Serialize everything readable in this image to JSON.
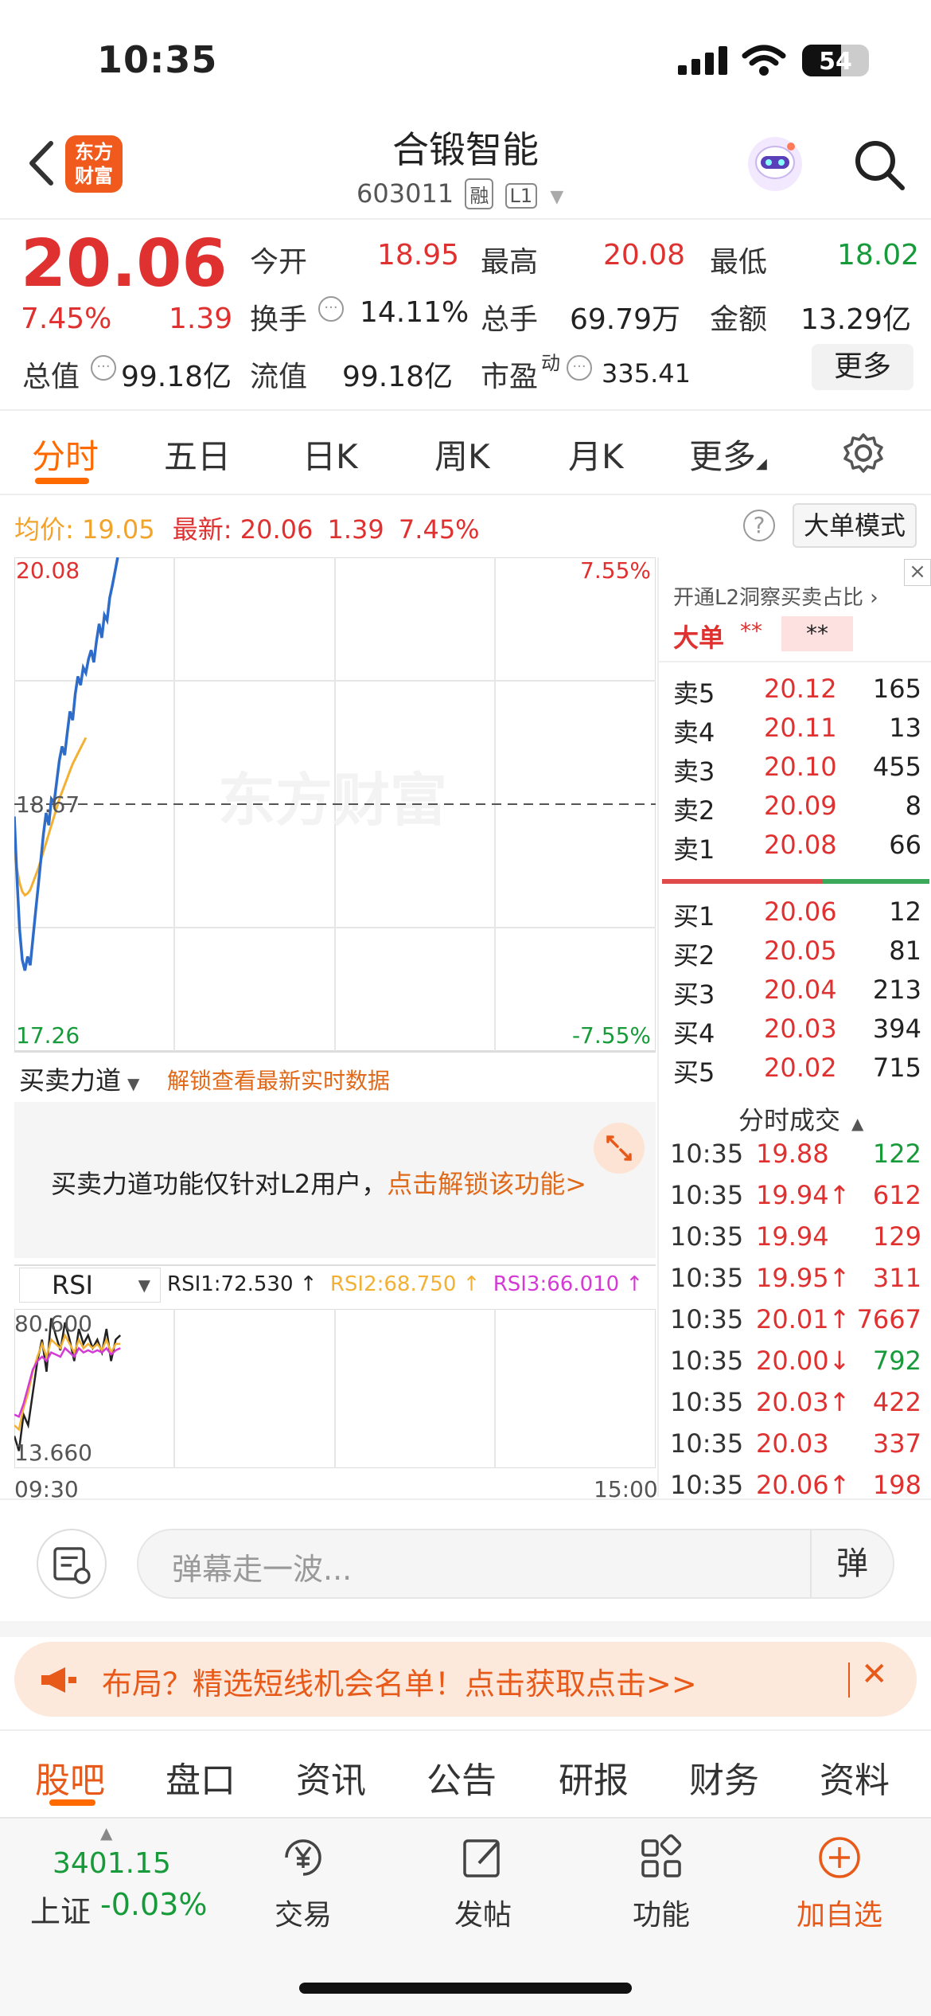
{
  "status_bar": {
    "time": "10:35",
    "battery": "54"
  },
  "header": {
    "logo_line1": "东方",
    "logo_line2": "财富",
    "stock_name": "合锻智能",
    "stock_code": "603011",
    "tag1": "融",
    "tag2": "L1"
  },
  "quote": {
    "price": "20.06",
    "change_pct": "7.45%",
    "change_amt": "1.39",
    "open_label": "今开",
    "open_value": "18.95",
    "high_label": "最高",
    "high_value": "20.08",
    "low_label": "最低",
    "low_value": "18.02",
    "turnover_label": "换手",
    "turnover_value": "14.11%",
    "volume_label": "总手",
    "volume_value": "69.79万",
    "amount_label": "金额",
    "amount_value": "13.29亿",
    "mktcap_label": "总值",
    "mktcap_value": "99.18亿",
    "float_label": "流值",
    "float_value": "99.18亿",
    "pe_label": "市盈",
    "pe_sup": "动",
    "pe_value": "335.41",
    "more_label": "更多"
  },
  "tabs": [
    "分时",
    "五日",
    "日K",
    "周K",
    "月K",
    "更多"
  ],
  "info_line": {
    "avg_label": "均价:",
    "avg_value": "19.05",
    "latest_label": "最新:",
    "latest_value": "20.06",
    "latest_chg": "1.39",
    "latest_pct": "7.45%",
    "bigorder_mode": "大单模式"
  },
  "chart": {
    "price_high": "20.08",
    "price_low": "17.26",
    "price_mid": "18.67",
    "pct_high": "7.55%",
    "pct_low": "-7.55%",
    "watermark": "东方财富",
    "time_start": "09:30",
    "time_end": "15:00"
  },
  "chart_data": {
    "type": "line",
    "ylim": [
      17.26,
      20.08
    ],
    "reference": 18.67,
    "series": [
      {
        "values": [
          18.6,
          18.25,
          17.95,
          17.78,
          17.72,
          17.8,
          17.75,
          17.9,
          18.05,
          18.2,
          18.35,
          18.5,
          18.62,
          18.55,
          18.7,
          18.68,
          18.8,
          18.92,
          19.0,
          18.95,
          19.08,
          19.2,
          19.15,
          19.3,
          19.4,
          19.35,
          19.45,
          19.42,
          19.5,
          19.55,
          19.48,
          19.6,
          19.7,
          19.62,
          19.75,
          19.72,
          19.85,
          19.92,
          20.0,
          20.08
        ]
      },
      {
        "values": [
          18.4,
          18.3,
          18.22,
          18.17,
          18.15,
          18.16,
          18.18,
          18.22,
          18.26,
          18.3,
          18.35,
          18.4,
          18.45,
          18.5,
          18.55,
          18.6,
          18.65,
          18.7,
          18.74,
          18.78,
          18.82,
          18.86,
          18.9,
          18.93,
          18.96,
          18.99,
          19.02,
          19.05
        ]
      }
    ]
  },
  "power": {
    "select_label": "买卖力道",
    "unlock_text": "解锁查看最新实时数据",
    "notice": "买卖力道功能仅针对L2用户，",
    "notice_link": "点击解锁该功能>"
  },
  "rsi": {
    "select_label": "RSI",
    "rsi1": "RSI1:72.530 ↑",
    "rsi2": "RSI2:68.750 ↑",
    "rsi3": "RSI3:66.010 ↑",
    "top": "80.600",
    "bottom": "13.660",
    "series_values": {
      "rsi1": [
        25,
        18,
        35,
        30,
        45,
        60,
        70,
        55,
        80,
        72,
        65,
        78,
        70,
        60,
        75,
        68,
        72,
        66,
        70,
        64,
        75,
        60,
        70,
        72
      ],
      "rsi2": [
        30,
        28,
        38,
        45,
        55,
        62,
        68,
        62,
        70,
        68,
        66,
        72,
        68,
        64,
        70,
        66,
        68,
        66,
        68,
        65,
        70,
        64,
        68,
        68
      ],
      "rsi3": [
        35,
        34,
        40,
        48,
        56,
        60,
        62,
        60,
        64,
        63,
        62,
        66,
        64,
        62,
        66,
        64,
        65,
        64,
        65,
        64,
        66,
        63,
        65,
        66
      ]
    }
  },
  "right_panel": {
    "l2_text": "开通L2洞察买卖占比",
    "bigorder_label": "大单",
    "bigorder_v1": "**",
    "bigorder_v2": "**",
    "sells": [
      {
        "label": "卖5",
        "price": "20.12",
        "vol": "165"
      },
      {
        "label": "卖4",
        "price": "20.11",
        "vol": "13"
      },
      {
        "label": "卖3",
        "price": "20.10",
        "vol": "455"
      },
      {
        "label": "卖2",
        "price": "20.09",
        "vol": "8"
      },
      {
        "label": "卖1",
        "price": "20.08",
        "vol": "66"
      }
    ],
    "buys": [
      {
        "label": "买1",
        "price": "20.06",
        "vol": "12"
      },
      {
        "label": "买2",
        "price": "20.05",
        "vol": "81"
      },
      {
        "label": "买3",
        "price": "20.04",
        "vol": "213"
      },
      {
        "label": "买4",
        "price": "20.03",
        "vol": "394"
      },
      {
        "label": "买5",
        "price": "20.02",
        "vol": "715"
      }
    ],
    "ticks_title": "分时成交",
    "ticks": [
      {
        "time": "10:35",
        "price": "19.88",
        "vol": "122",
        "dir": "green"
      },
      {
        "time": "10:35",
        "price": "19.94↑",
        "vol": "612",
        "dir": "red"
      },
      {
        "time": "10:35",
        "price": "19.94",
        "vol": "129",
        "dir": "red"
      },
      {
        "time": "10:35",
        "price": "19.95↑",
        "vol": "311",
        "dir": "red"
      },
      {
        "time": "10:35",
        "price": "20.01↑",
        "vol": "7667",
        "dir": "red"
      },
      {
        "time": "10:35",
        "price": "20.00↓",
        "vol": "792",
        "dir": "green"
      },
      {
        "time": "10:35",
        "price": "20.03↑",
        "vol": "422",
        "dir": "red"
      },
      {
        "time": "10:35",
        "price": "20.03",
        "vol": "337",
        "dir": "red"
      },
      {
        "time": "10:35",
        "price": "20.06↑",
        "vol": "198",
        "dir": "red"
      }
    ]
  },
  "danmu": {
    "placeholder": "弹幕走一波...",
    "button": "弹"
  },
  "promo": {
    "text": "布局？精选短线机会名单！点击获取点击>>"
  },
  "bottom_tabs": [
    "股吧",
    "盘口",
    "资讯",
    "公告",
    "研报",
    "财务",
    "资料"
  ],
  "nav": {
    "index_value": "3401.15",
    "index_label": "上证",
    "index_pct": "-0.03%",
    "items": [
      "交易",
      "发帖",
      "功能",
      "加自选"
    ]
  }
}
